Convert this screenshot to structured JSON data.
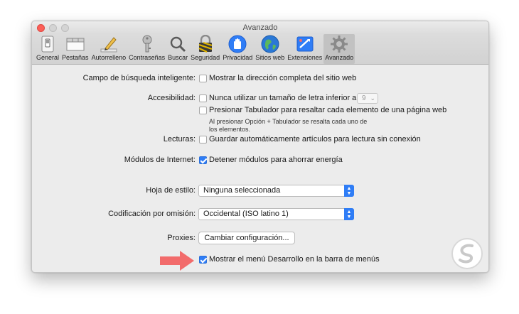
{
  "window": {
    "title": "Avanzado"
  },
  "toolbar": {
    "items": [
      {
        "label": "General",
        "icon": "general-switch-icon"
      },
      {
        "label": "Pestañas",
        "icon": "tabs-icon"
      },
      {
        "label": "Autorrelleno",
        "icon": "autofill-pencil-icon"
      },
      {
        "label": "Contraseñas",
        "icon": "key-icon"
      },
      {
        "label": "Buscar",
        "icon": "magnifier-icon"
      },
      {
        "label": "Seguridad",
        "icon": "padlock-icon"
      },
      {
        "label": "Privacidad",
        "icon": "privacy-hand-icon"
      },
      {
        "label": "Sitios web",
        "icon": "globe-icon"
      },
      {
        "label": "Extensiones",
        "icon": "extensions-icon"
      },
      {
        "label": "Avanzado",
        "icon": "gear-icon",
        "active": true
      }
    ]
  },
  "smart_search": {
    "label": "Campo de búsqueda inteligente:",
    "option": "Mostrar la dirección completa del sitio web",
    "checked": false
  },
  "accessibility": {
    "label": "Accesibilidad:",
    "option1": "Nunca utilizar un tamaño de letra inferior a",
    "font_size": "9",
    "option1_checked": false,
    "option2": "Presionar Tabulador para resaltar cada elemento de una página web",
    "option2_checked": false,
    "note_line1": "Al presionar Opción + Tabulador se resalta cada uno de",
    "note_line2": "los elementos."
  },
  "reading": {
    "label": "Lecturas:",
    "option": "Guardar automáticamente artículos para lectura sin conexión",
    "checked": false
  },
  "plugins": {
    "label": "Módulos de Internet:",
    "option": "Detener módulos para ahorrar energía",
    "checked": true
  },
  "stylesheet": {
    "label": "Hoja de estilo:",
    "value": "Ninguna seleccionada"
  },
  "encoding": {
    "label": "Codificación por omisión:",
    "value": "Occidental (ISO latino 1)"
  },
  "proxies": {
    "label": "Proxies:",
    "button": "Cambiar configuración..."
  },
  "develop_menu": {
    "option": "Mostrar el menú Desarrollo en la barra de menús",
    "checked": true
  },
  "colors": {
    "accent": "#2f7df6",
    "arrow": "#f26b6b"
  }
}
